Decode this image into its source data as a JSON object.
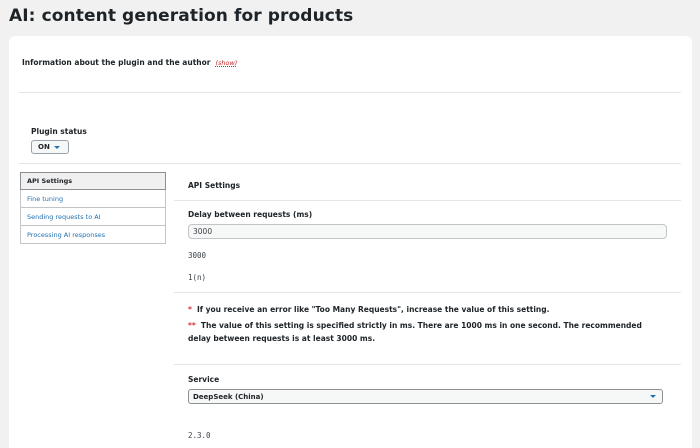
{
  "page_title": "AI: content generation for products",
  "info": {
    "label": "Information about the plugin and the author",
    "show_link": "(show)"
  },
  "plugin_status": {
    "label": "Plugin status",
    "value": "ON"
  },
  "tabs": [
    {
      "label": "API Settings",
      "active": true
    },
    {
      "label": "Fine tuning",
      "active": false
    },
    {
      "label": "Sending requests to AI",
      "active": false
    },
    {
      "label": "Processing AI responses",
      "active": false
    }
  ],
  "api_settings": {
    "section_title": "API Settings",
    "delay_label": "Delay between requests (ms)",
    "delay_value": "3000",
    "delay_echo": "3000",
    "delay_type": "1(n)",
    "note1_marker": "*",
    "note1": "If you receive an error like \"Too Many Requests\", increase the value of this setting.",
    "note2_marker": "**",
    "note2": "The value of this setting is specified strictly in ms. There are 1000 ms in one second. The recommended delay between requests is at least 3000 ms.",
    "service_label": "Service",
    "service_value": "DeepSeek (China)",
    "version": "2.3.0"
  },
  "colors": {
    "link": "#2271b1",
    "red": "#d63638",
    "background": "#f1f1f1"
  }
}
